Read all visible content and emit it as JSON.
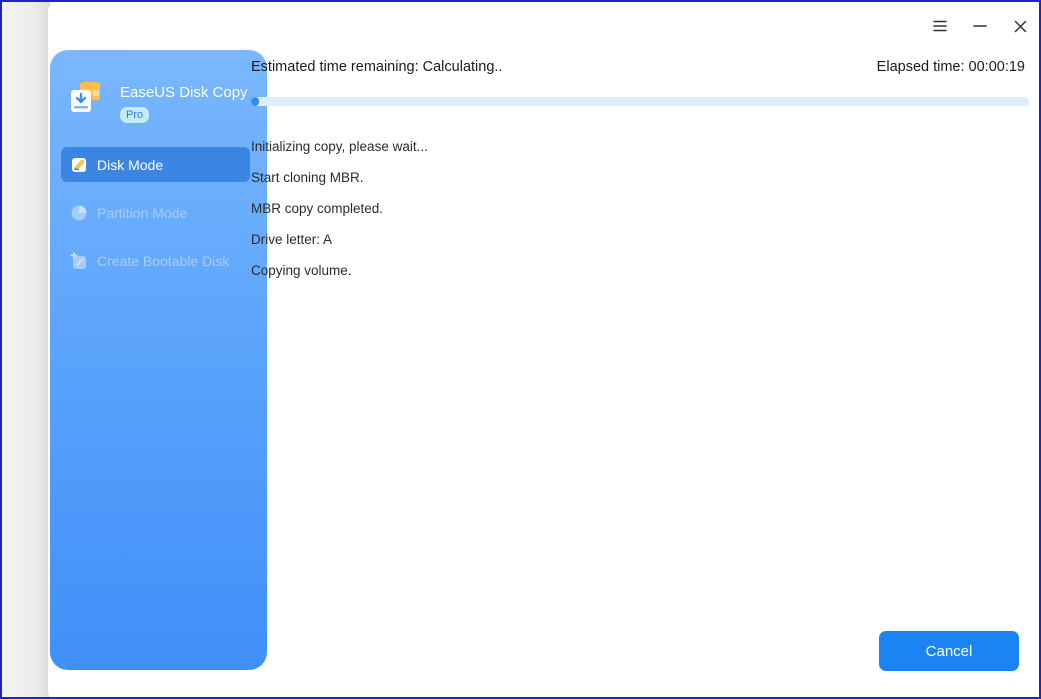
{
  "app": {
    "name": "EaseUS Disk Copy",
    "edition_badge": "Pro"
  },
  "sidebar": {
    "items": [
      {
        "label": "Disk Mode",
        "state": "active",
        "icon": "disk-icon"
      },
      {
        "label": "Partition Mode",
        "state": "disabled",
        "icon": "pie-chart-icon"
      },
      {
        "label": "Create Bootable Disk",
        "state": "disabled",
        "icon": "bootable-disk-icon"
      }
    ]
  },
  "window_controls": {
    "menu_icon": "hamburger-menu-icon",
    "minimize_icon": "minimize-icon",
    "close_icon": "close-icon"
  },
  "progress": {
    "estimated_label": "Estimated time remaining: Calculating..",
    "elapsed_label": "Elapsed time: 00:00:19",
    "fraction": 0.01
  },
  "log": [
    "Initializing copy, please wait...",
    "Start cloning MBR.",
    "MBR copy completed.",
    "Drive letter: A",
    "Copying volume."
  ],
  "actions": {
    "cancel_label": "Cancel"
  },
  "colors": {
    "accent": "#1a84f3",
    "sidebar_top": "#7ab7fd",
    "sidebar_bottom": "#3f8ff8",
    "progress_track": "#dceefc",
    "progress_fill": "#2f8ef2",
    "frame_border": "#1f23c8"
  }
}
